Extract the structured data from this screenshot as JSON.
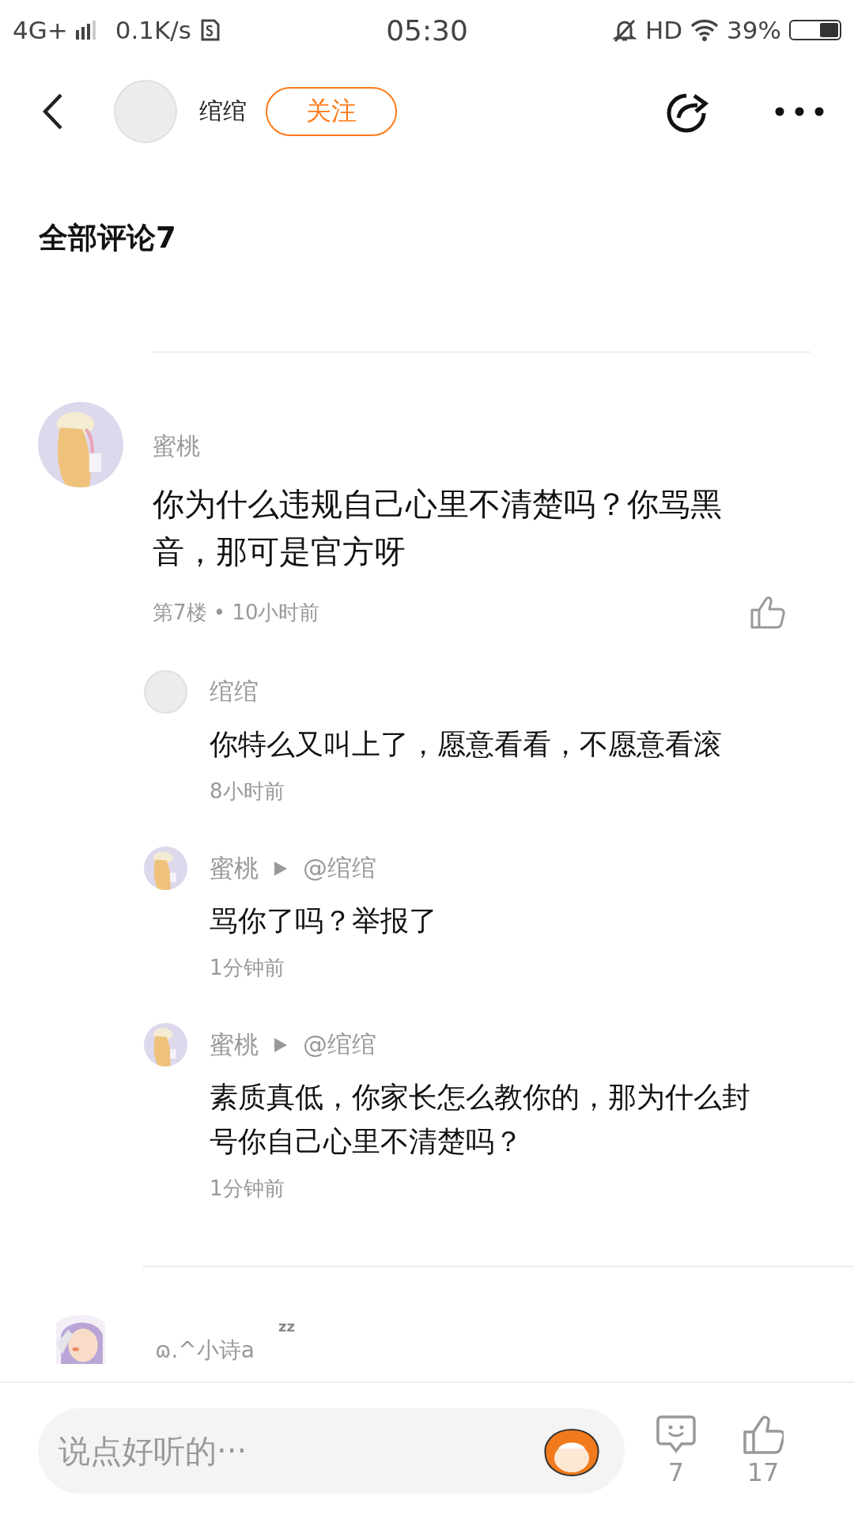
{
  "status_bar": {
    "network": "4G+",
    "speed": "0.1K/s",
    "time": "05:30",
    "hd": "HD",
    "battery": "39%"
  },
  "header": {
    "author": "绾绾",
    "author_avatar": {
      "kind": "plain"
    },
    "follow_label": "关注"
  },
  "section_title": "全部评论7",
  "comments": [
    {
      "name": "蜜桃",
      "text": "你为什么违规自己心里不清楚吗？你骂黑音，那可是官方呀",
      "meta": "第7楼 • 10小时前",
      "replies": [
        {
          "name": "绾绾",
          "avatar": {
            "kind": "plain"
          },
          "text": "你特么又叫上了，愿意看看，不愿意看滚",
          "time": "8小时前"
        },
        {
          "name": "蜜桃",
          "reply_to": "@绾绾",
          "text": "骂你了吗？举报了",
          "time": "1分钟前"
        },
        {
          "name": "蜜桃",
          "reply_to": "@绾绾",
          "text": "素质真低，你家长怎么教你的，那为什么封号你自己心里不清楚吗？",
          "time": "1分钟前"
        }
      ]
    }
  ],
  "next_comment": {
    "name": "ɷ.^小诗a",
    "badge": "zz"
  },
  "bottom_bar": {
    "placeholder": "说点好听的···",
    "comment_count": "7",
    "like_count": "17"
  }
}
